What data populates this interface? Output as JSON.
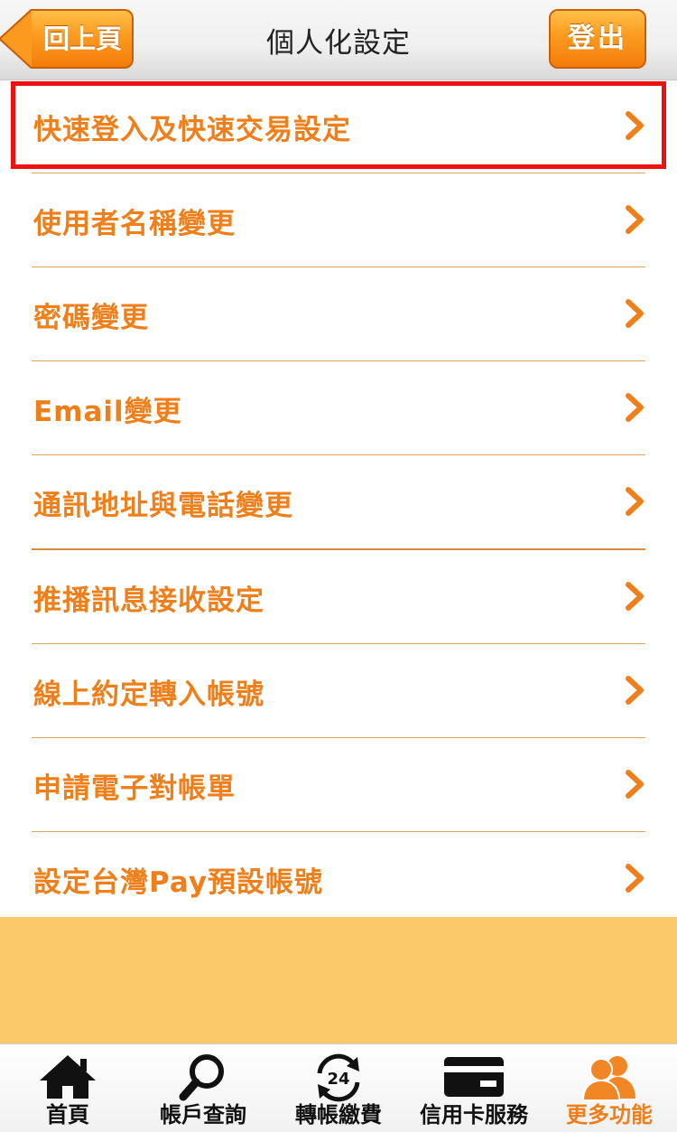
{
  "header": {
    "title": "個人化設定",
    "back_label": "回上頁",
    "logout_label": "登出"
  },
  "menu": {
    "items": [
      {
        "label": "快速登入及快速交易設定"
      },
      {
        "label": "使用者名稱變更"
      },
      {
        "label": "密碼變更"
      },
      {
        "label": "Email變更"
      },
      {
        "label": "通訊地址與電話變更"
      },
      {
        "label": "推播訊息接收設定"
      },
      {
        "label": "線上約定轉入帳號"
      },
      {
        "label": "申請電子對帳單"
      },
      {
        "label": "設定台灣Pay預設帳號"
      }
    ]
  },
  "tabbar": {
    "tabs": [
      {
        "label": "首頁",
        "icon": "home-icon"
      },
      {
        "label": "帳戶查詢",
        "icon": "magnifier-icon"
      },
      {
        "label": "轉帳繳費",
        "icon": "transfer-24-icon",
        "badge": "24"
      },
      {
        "label": "信用卡服務",
        "icon": "credit-card-icon"
      },
      {
        "label": "更多功能",
        "icon": "users-icon",
        "active": true
      }
    ]
  },
  "colors": {
    "accent": "#ef7f1a",
    "highlight_border": "#ee1111",
    "filler": "#fbc96a"
  }
}
